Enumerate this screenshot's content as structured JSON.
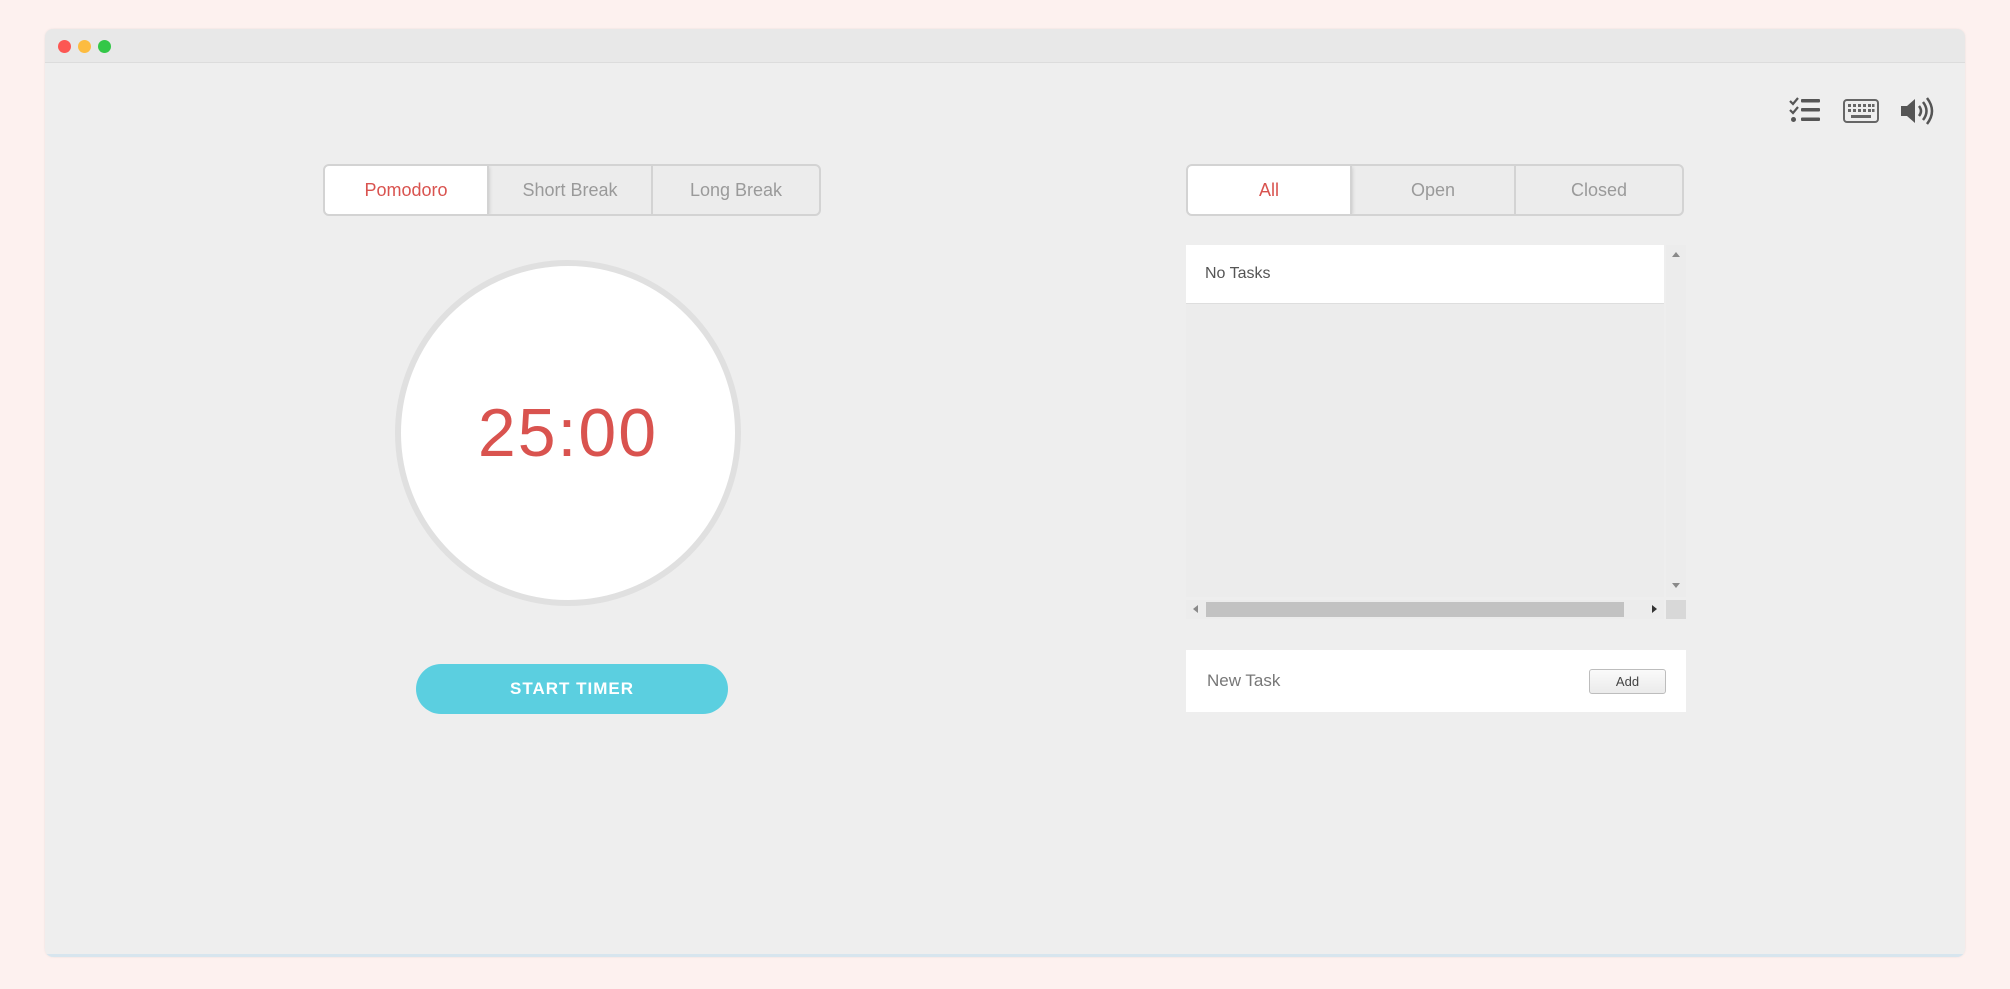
{
  "window": {
    "traffic_lights": [
      "close",
      "minimize",
      "zoom"
    ]
  },
  "toolbar": {
    "icons": [
      "tasks-icon",
      "keyboard-icon",
      "volume-icon"
    ]
  },
  "timer_modes": {
    "tabs": [
      {
        "label": "Pomodoro",
        "active": true
      },
      {
        "label": "Short Break",
        "active": false
      },
      {
        "label": "Long Break",
        "active": false
      }
    ]
  },
  "timer": {
    "display": "25:00",
    "start_label": "START TIMER"
  },
  "task_filters": {
    "tabs": [
      {
        "label": "All",
        "active": true
      },
      {
        "label": "Open",
        "active": false
      },
      {
        "label": "Closed",
        "active": false
      }
    ]
  },
  "tasks": {
    "empty_label": "No Tasks",
    "items": []
  },
  "new_task": {
    "placeholder": "New Task",
    "value": "",
    "add_label": "Add"
  },
  "colors": {
    "accent_red": "#d9534f",
    "start_button": "#5bcfe0",
    "background": "#eeeeee"
  }
}
